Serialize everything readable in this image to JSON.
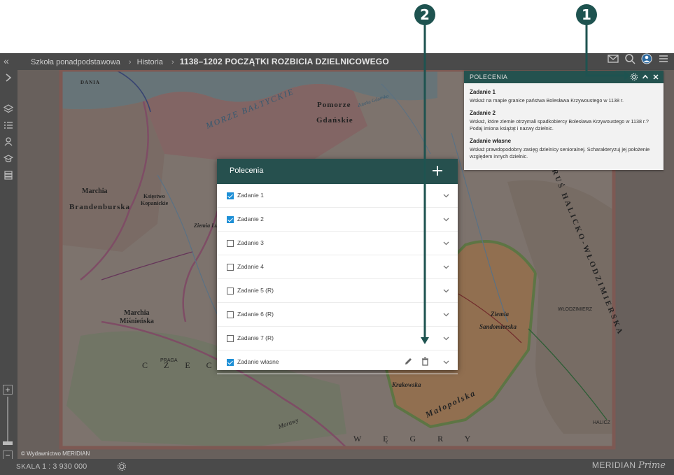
{
  "breadcrumb": {
    "items": [
      "Szkoła ponadpodstawowa",
      "Historia"
    ],
    "current": "1138–1202 POCZĄTKI ROZBICIA DZIELNICOWEGO",
    "separator": "›"
  },
  "topbar_icons": [
    "mail-icon",
    "search-icon",
    "user-icon",
    "menu-icon"
  ],
  "sidebar_icons": [
    "layers-icon",
    "list-icon",
    "pin-icon",
    "graduation-icon",
    "stack-icon"
  ],
  "map_labels": {
    "sea": "MORZE BAŁTYCKIE",
    "dania": "DANIA",
    "pomorze": "Pomorze",
    "gdanskie": "Gdańskie",
    "brandenburska": "Brandenburska",
    "marchia1": "Marchia",
    "marchia2": "Marchia",
    "miśnieńska": "Miśnieńska",
    "czechy": "C Z E C H Y",
    "wegry": "W Ę G R Y",
    "krakowska": "Krakowska",
    "malopolska": "Małopolska",
    "ziemia": "Ziemia",
    "sandomierska": "Sandomierska",
    "halicko": "RUŚ HALICKO-WŁODZIMIERSKA",
    "wlodzimierz": "WŁODZIMIERZ",
    "halicz": "HALICZ",
    "zatoka": "Zatoka Gdańska",
    "ksiestwo": "Księstwo",
    "kopanickie": "Kopanickie",
    "morawy": "Morawy",
    "praga": "PRAGA",
    "ziemia_lubuska": "Ziemia Lubuska"
  },
  "panel": {
    "title": "POLECENIA",
    "tasks": [
      {
        "title": "Zadanie 1",
        "text": "Wskaż na mapie granice państwa Bolesława Krzywoustego w 1138 r."
      },
      {
        "title": "Zadanie 2",
        "text": "Wskaż, które ziemie otrzymali spadkobiercy Bolesława Krzywoustego w 1138 r.? Podaj imiona książąt i nazwy dzielnic."
      },
      {
        "title": "Zadanie własne",
        "text": "Wskaż prawdopodobny zasięg dzielnicy senioralnej. Scharakteryzuj jej położenie względem innych dzielnic."
      }
    ]
  },
  "modal": {
    "title": "Polecenia",
    "add_symbol": "+",
    "rows": [
      {
        "label": "Zadanie 1",
        "checked": true
      },
      {
        "label": "Zadanie 2",
        "checked": true
      },
      {
        "label": "Zadanie 3",
        "checked": false
      },
      {
        "label": "Zadanie 4",
        "checked": false
      },
      {
        "label": "Zadanie 5 (R)",
        "checked": false
      },
      {
        "label": "Zadanie 6 (R)",
        "checked": false
      },
      {
        "label": "Zadanie 7 (R)",
        "checked": false
      },
      {
        "label": "Zadanie własne",
        "checked": true
      }
    ]
  },
  "bottombar": {
    "scale_label": "SKALA",
    "scale_value": "1 : 3 930 000",
    "brand1": "MERIDIAN",
    "brand2": "Prime"
  },
  "copyright": "© Wydawnictwo MERIDIAN",
  "callouts": {
    "one": "1",
    "two": "2"
  },
  "zoom": {
    "plus": "+",
    "minus": "−"
  },
  "colors": {
    "teal": "#26504e",
    "check": "#1d8fd6",
    "callout": "#1e5350"
  }
}
